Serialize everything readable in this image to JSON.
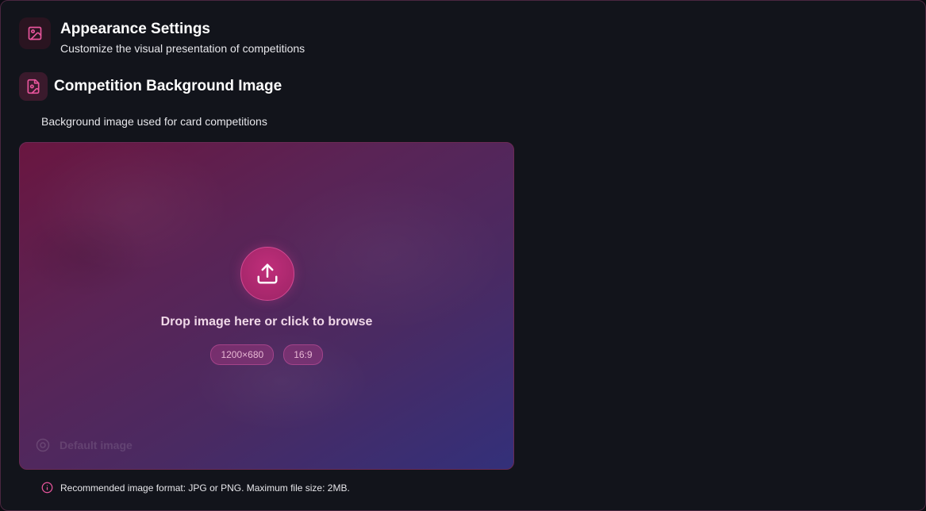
{
  "header": {
    "icon": "image-icon",
    "title": "Appearance Settings",
    "subtitle": "Customize the visual presentation of competitions"
  },
  "section": {
    "icon": "file-image-icon",
    "title": "Competition Background Image",
    "description": "Background image used for card competitions"
  },
  "dropzone": {
    "icon": "upload-icon",
    "prompt": "Drop image here or click to browse",
    "chips": [
      "1200×680",
      "16:9"
    ],
    "default_label": "Default image"
  },
  "note": {
    "icon": "info-icon",
    "text": "Recommended image format: JPG or PNG. Maximum file size: 2MB."
  },
  "colors": {
    "accent": "#e8559c",
    "background": "#12141b",
    "border": "#4a2740"
  }
}
